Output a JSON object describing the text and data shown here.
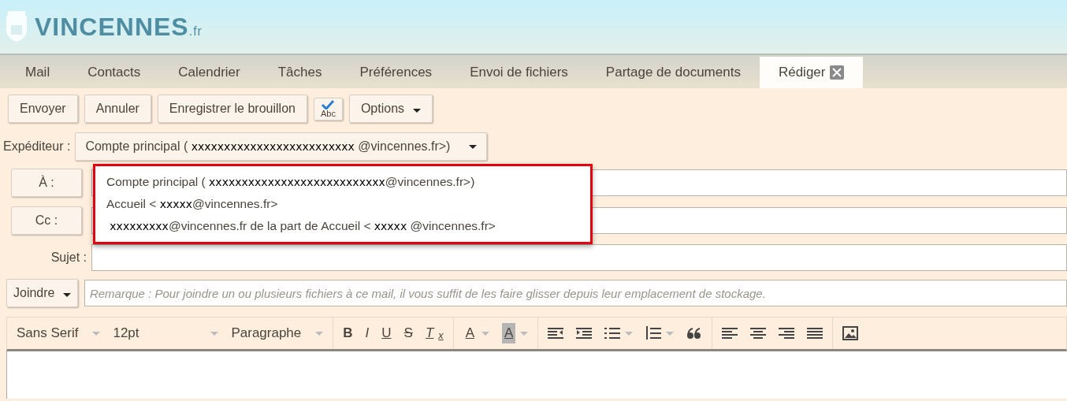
{
  "logo": {
    "name": "VINCENNES",
    "suffix": ".fr"
  },
  "tabs": [
    {
      "label": "Mail",
      "selected": false,
      "closable": false
    },
    {
      "label": "Contacts",
      "selected": false,
      "closable": false
    },
    {
      "label": "Calendrier",
      "selected": false,
      "closable": false
    },
    {
      "label": "Tâches",
      "selected": false,
      "closable": false
    },
    {
      "label": "Préférences",
      "selected": false,
      "closable": false
    },
    {
      "label": "Envoi de fichiers",
      "selected": false,
      "closable": false
    },
    {
      "label": "Partage de documents",
      "selected": false,
      "closable": false
    },
    {
      "label": "Rédiger",
      "selected": true,
      "closable": true
    }
  ],
  "toolbar": {
    "buttons": [
      "Envoyer",
      "Annuler",
      "Enregistrer le brouillon"
    ],
    "spellcheck": "Abc",
    "options": "Options"
  },
  "sender": {
    "label": "Expéditeur :",
    "value": "Compte principal ( **xxxxxxxxxxxxxxxxxxxxxxxxx** @vincennes.fr>)"
  },
  "sender_menu": [
    "Compte principal ( **xxxxxxxxxxxxxxxxxxxxxxxxxxx**@vincennes.fr>)",
    "Accueil < **xxxxx**@vincennes.fr>",
    " **xxxxxxxxx**@vincennes.fr de la part de Accueil < **xxxxx** @vincennes.fr>"
  ],
  "to": {
    "label": "À :"
  },
  "cc": {
    "label": "Cc :"
  },
  "subject": {
    "label": "Sujet :"
  },
  "attach": {
    "label": "Joindre",
    "placeholder": "Remarque : Pour joindre un ou plusieurs fichiers à ce mail, il vous suffit de les faire glisser depuis leur emplacement de stockage."
  },
  "editor_toolbar": {
    "font": "Sans Serif",
    "size": "12pt",
    "format": "Paragraphe",
    "format_buttons": [
      "B",
      "I",
      "U",
      "S",
      "T$_{x}$"
    ],
    "color_buttons": [
      "A",
      "A"
    ]
  }
}
